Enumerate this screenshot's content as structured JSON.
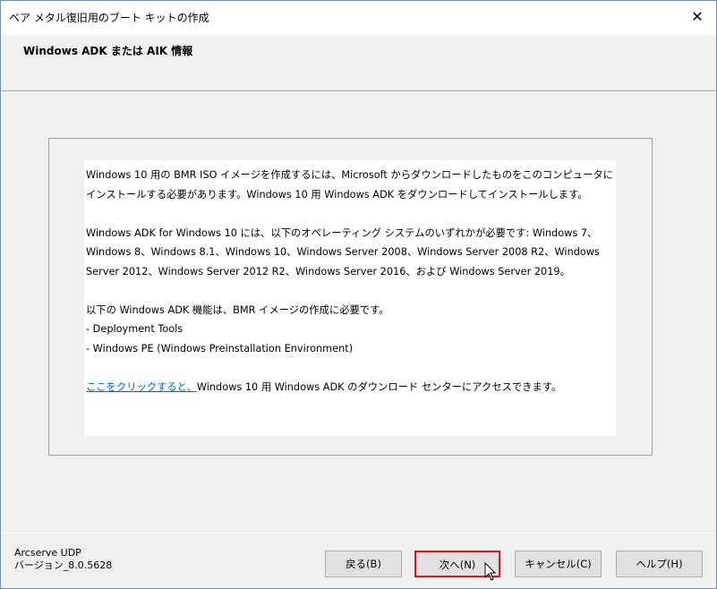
{
  "window": {
    "title": "ベア メタル復旧用のブート キットの作成",
    "close": "✕"
  },
  "header": {
    "title": "Windows ADK または AIK 情報"
  },
  "content": {
    "p1": "Windows 10 用の BMR ISO イメージを作成するには、Microsoft からダウンロードしたものをこのコンピュータにインストールする必要があります。Windows 10 用 Windows ADK をダウンロードしてインストールします。",
    "p2": "Windows ADK for Windows 10 には、以下のオペレーティング システムのいずれかが必要です: Windows 7、Windows 8、Windows 8.1、Windows 10、Windows Server 2008、Windows Server 2008 R2、Windows Server 2012、Windows Server 2012 R2、Windows Server 2016、および Windows Server 2019。",
    "p3": "以下の Windows ADK 機能は、BMR イメージの作成に必要です。",
    "items": [
      "- Deployment Tools",
      "- Windows PE (Windows Preinstallation Environment)"
    ],
    "link": "ここをクリックすると、",
    "link_rest": "Windows 10 用 Windows ADK のダウンロード センターにアクセスできます。"
  },
  "footer": {
    "product": "Arcserve UDP",
    "version": "バージョン_8.0.5628"
  },
  "buttons": {
    "back": "戻る(B)",
    "next": "次へ(N)",
    "cancel": "キャンセル(C)",
    "help": "ヘルプ(H)"
  }
}
